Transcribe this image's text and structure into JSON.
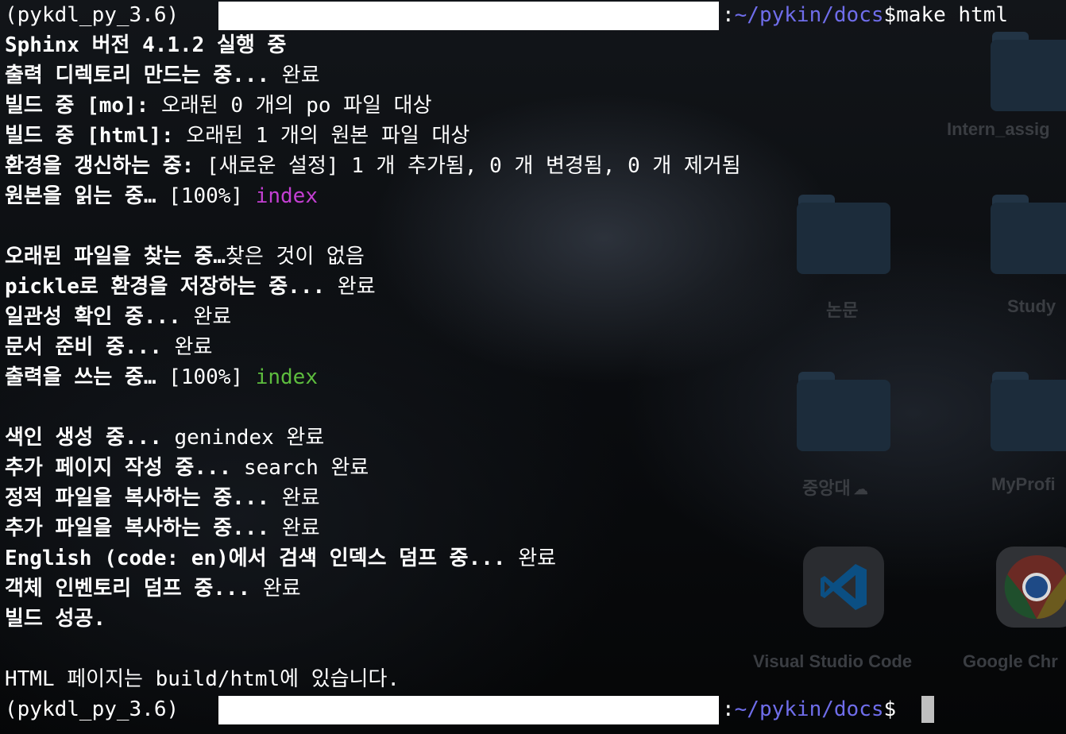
{
  "terminal": {
    "prompt_env": "(pykdl_py_3.6)",
    "prompt_colon": ":",
    "prompt_path": "~/pykin/docs",
    "prompt_symbol": "$",
    "command": "make html",
    "lines": {
      "sphinx": "Sphinx 버전 4.1.2 실행 중",
      "outdir_label": "출력 디렉토리 만드는 중...",
      "outdir_result": " 완료",
      "mo_label": "빌드 중 [mo]:",
      "mo_result": " 오래된 0 개의 po 파일 대상",
      "html_label": "빌드 중 [html]:",
      "html_result": " 오래된 1 개의 원본 파일 대상",
      "env_label": "환경을 갱신하는 중:",
      "env_result": " [새로운 설정] 1 개 추가됨, 0 개 변경됨, 0 개 제거됨",
      "read_label": "원본을 읽는 중…",
      "read_progress": " [100%] ",
      "read_item": "index",
      "outdated_label": "오래된 파일을 찾는 중…",
      "outdated_result": "찾은 것이 없음",
      "pickle_label": "pickle로 환경을 저장하는 중...",
      "pickle_result": " 완료",
      "consistency_label": "일관성 확인 중...",
      "consistency_result": " 완료",
      "prepare_label": "문서 준비 중...",
      "prepare_result": " 완료",
      "write_label": "출력을 쓰는 중…",
      "write_progress": " [100%] ",
      "write_item": "index",
      "genindex_label": "색인 생성 중...",
      "genindex_result": " genindex 완료",
      "extra_pages_label": "추가 페이지 작성 중...",
      "extra_pages_result": " search 완료",
      "static_label": "정적 파일을 복사하는 중...",
      "static_result": " 완료",
      "extra_files_label": "추가 파일을 복사하는 중...",
      "extra_files_result": " 완료",
      "search_index_label": "English (code: en)에서 검색 인덱스 덤프 중...",
      "search_index_result": " 완료",
      "inventory_label": "객체 인벤토리 덤프 중...",
      "inventory_result": " 완료",
      "success": "빌드 성공.",
      "html_pages": "HTML 페이지는 build/html에 있습니다."
    }
  },
  "desktop": {
    "items": {
      "intern": "Intern_assig",
      "nonmun": "논문",
      "study": "Study",
      "cau": "중앙대",
      "myprofile": "MyProfi",
      "vscode": "Visual Studio Code",
      "chrome": "Google Chr"
    }
  },
  "colors": {
    "path": "#6f6dea",
    "magenta_item": "#c43fd3",
    "green_item": "#5dbd3e"
  }
}
